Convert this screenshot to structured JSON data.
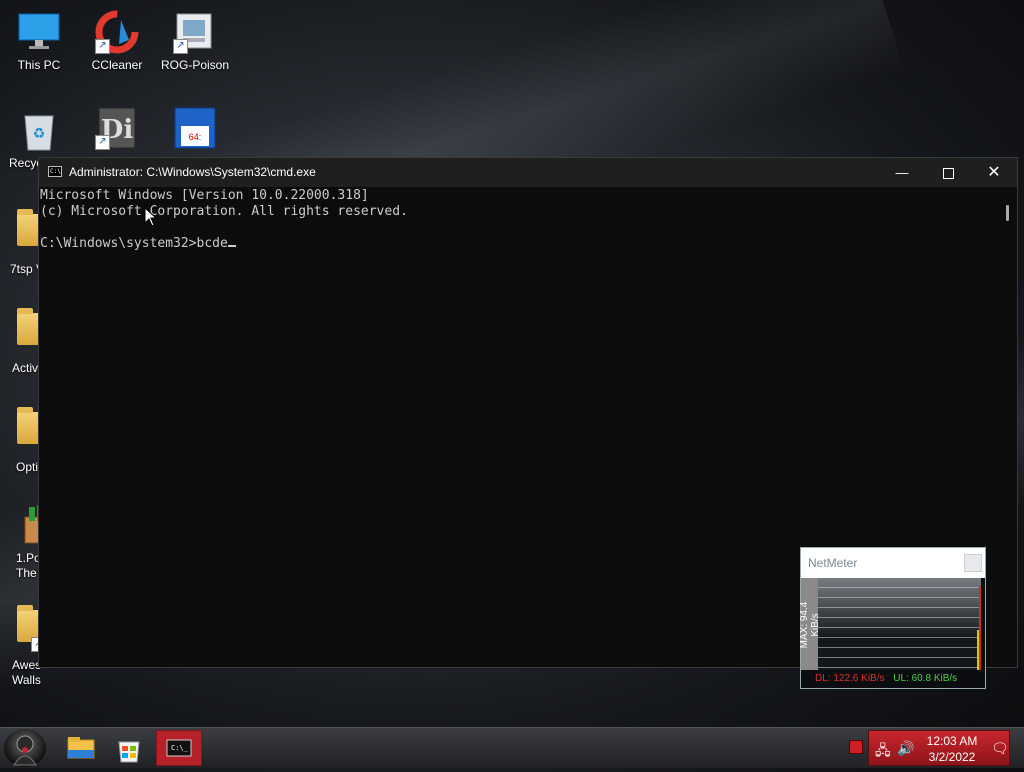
{
  "desktop": {
    "icons": [
      {
        "label": "This PC",
        "icon": "this-pc-icon"
      },
      {
        "label": "CCleaner",
        "icon": "ccleaner-icon"
      },
      {
        "label": "ROG-Poison",
        "icon": "rog-poison-icon"
      },
      {
        "label": "Recyc",
        "icon": "recycle-bin-icon"
      },
      {
        "label": "",
        "icon": "di-app-icon"
      },
      {
        "label": "",
        "icon": "floppy-64-icon"
      },
      {
        "label": "7tsp V",
        "icon": "folder-icon"
      },
      {
        "label": "Activ",
        "icon": "folder-icon"
      },
      {
        "label": "Opti",
        "icon": "folder-icon"
      },
      {
        "label": "1.Po The",
        "icon": "package-icon"
      },
      {
        "label": "Awes Walls",
        "icon": "folder-icon"
      }
    ]
  },
  "cmd": {
    "title": "Administrator: C:\\Windows\\System32\\cmd.exe",
    "lines": [
      "Microsoft Windows [Version 10.0.22000.318]",
      "(c) Microsoft Corporation. All rights reserved.",
      "",
      "C:\\Windows\\system32>bcde"
    ]
  },
  "netmeter": {
    "title": "NetMeter",
    "max_label": "MAX: 94.4 KiB/s",
    "dl": "DL: 122.6 KiB/s",
    "ul": "UL: 60.8 KiB/s"
  },
  "taskbar": {
    "items": [
      "start-icon",
      "file-explorer-icon",
      "store-icon",
      "cmd-icon"
    ],
    "time": "12:03 AM",
    "date": "3/2/2022"
  },
  "colors": {
    "accent_red": "#b5222a",
    "console_bg": "#0c0c0c",
    "console_text": "#cccccc"
  }
}
